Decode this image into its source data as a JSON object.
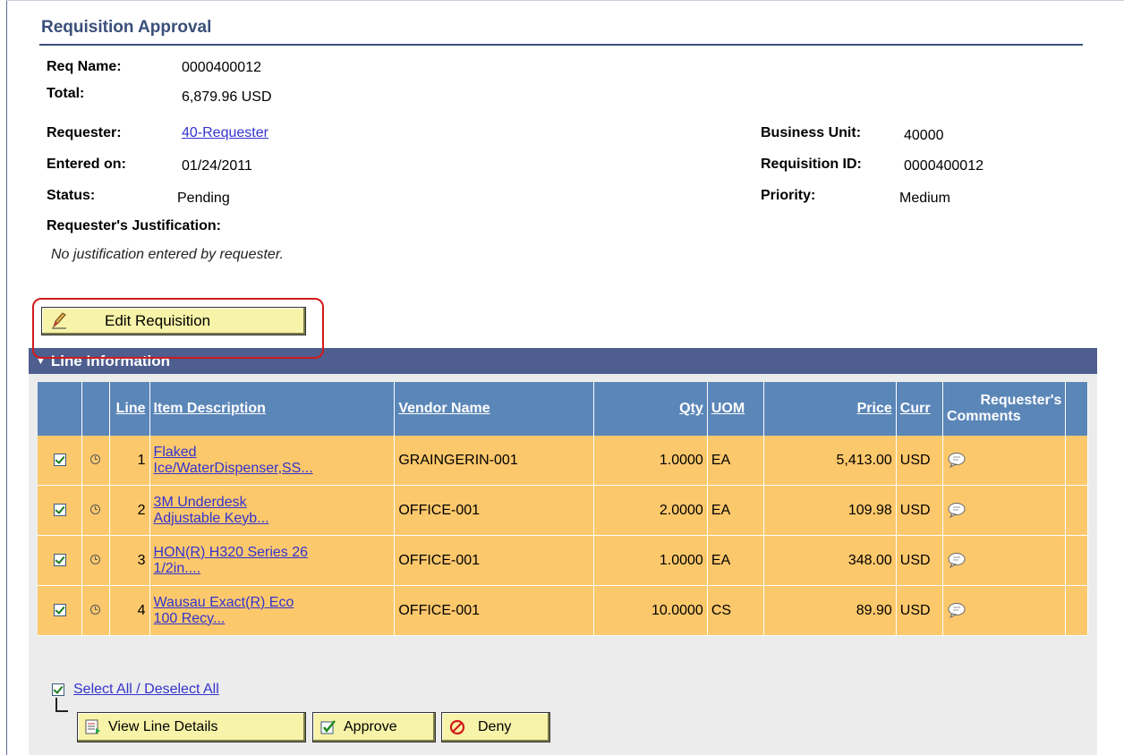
{
  "page": {
    "title": "Requisition Approval"
  },
  "details": {
    "req_name_label": "Req Name:",
    "req_name": "0000400012",
    "total_label": "Total:",
    "total": "6,879.96 USD",
    "requester_label": "Requester:",
    "requester": "40-Requester",
    "entered_on_label": "Entered on:",
    "entered_on": "01/24/2011",
    "status_label": "Status:",
    "status": "Pending",
    "justification_label": "Requester's Justification:",
    "justification": "No justification entered by requester.",
    "business_unit_label": "Business Unit:",
    "business_unit": "40000",
    "requisition_id_label": "Requisition ID:",
    "requisition_id": "0000400012",
    "priority_label": "Priority:",
    "priority": "Medium"
  },
  "edit_button": {
    "label": "Edit Requisition",
    "icon": "pencil-icon"
  },
  "section": {
    "title": "Line Information",
    "icon": "collapse-arrow-icon"
  },
  "grid": {
    "headers": {
      "line": "Line",
      "item_description": "Item Description",
      "vendor_name": "Vendor Name",
      "qty": "Qty",
      "uom": "UOM",
      "price": "Price",
      "curr": "Curr",
      "comments_line1": "Requester's",
      "comments_line2": "Comments"
    },
    "rows": [
      {
        "line": "1",
        "item_line1": "Flaked",
        "item_line2": "Ice/WaterDispenser,SS...",
        "vendor": "GRAINGERIN-001",
        "qty": "1.0000",
        "uom": "EA",
        "price": "5,413.00",
        "curr": "USD"
      },
      {
        "line": "2",
        "item_line1": "3M Underdesk",
        "item_line2": "Adjustable Keyb...",
        "vendor": "OFFICE-001",
        "qty": "2.0000",
        "uom": "EA",
        "price": "109.98",
        "curr": "USD"
      },
      {
        "line": "3",
        "item_line1": "HON(R) H320 Series 26",
        "item_line2": "1/2in....",
        "vendor": "OFFICE-001",
        "qty": "1.0000",
        "uom": "EA",
        "price": "348.00",
        "curr": "USD"
      },
      {
        "line": "4",
        "item_line1": "Wausau Exact(R) Eco",
        "item_line2": "100 Recy...",
        "vendor": "OFFICE-001",
        "qty": "10.0000",
        "uom": "CS",
        "price": "89.90",
        "curr": "USD"
      }
    ]
  },
  "actions": {
    "select_all": "Select All / Deselect All",
    "view_line_details": "View Line Details",
    "approve": "Approve",
    "deny": "Deny"
  },
  "colors": {
    "title": "#3a4f7a",
    "section_bar": "#4d5e8f",
    "grid_header": "#5b86b8",
    "row_bg": "#fcc86c",
    "button_bg": "#f7f3a8",
    "highlight": "#d11a1a",
    "link": "#3333cc"
  }
}
